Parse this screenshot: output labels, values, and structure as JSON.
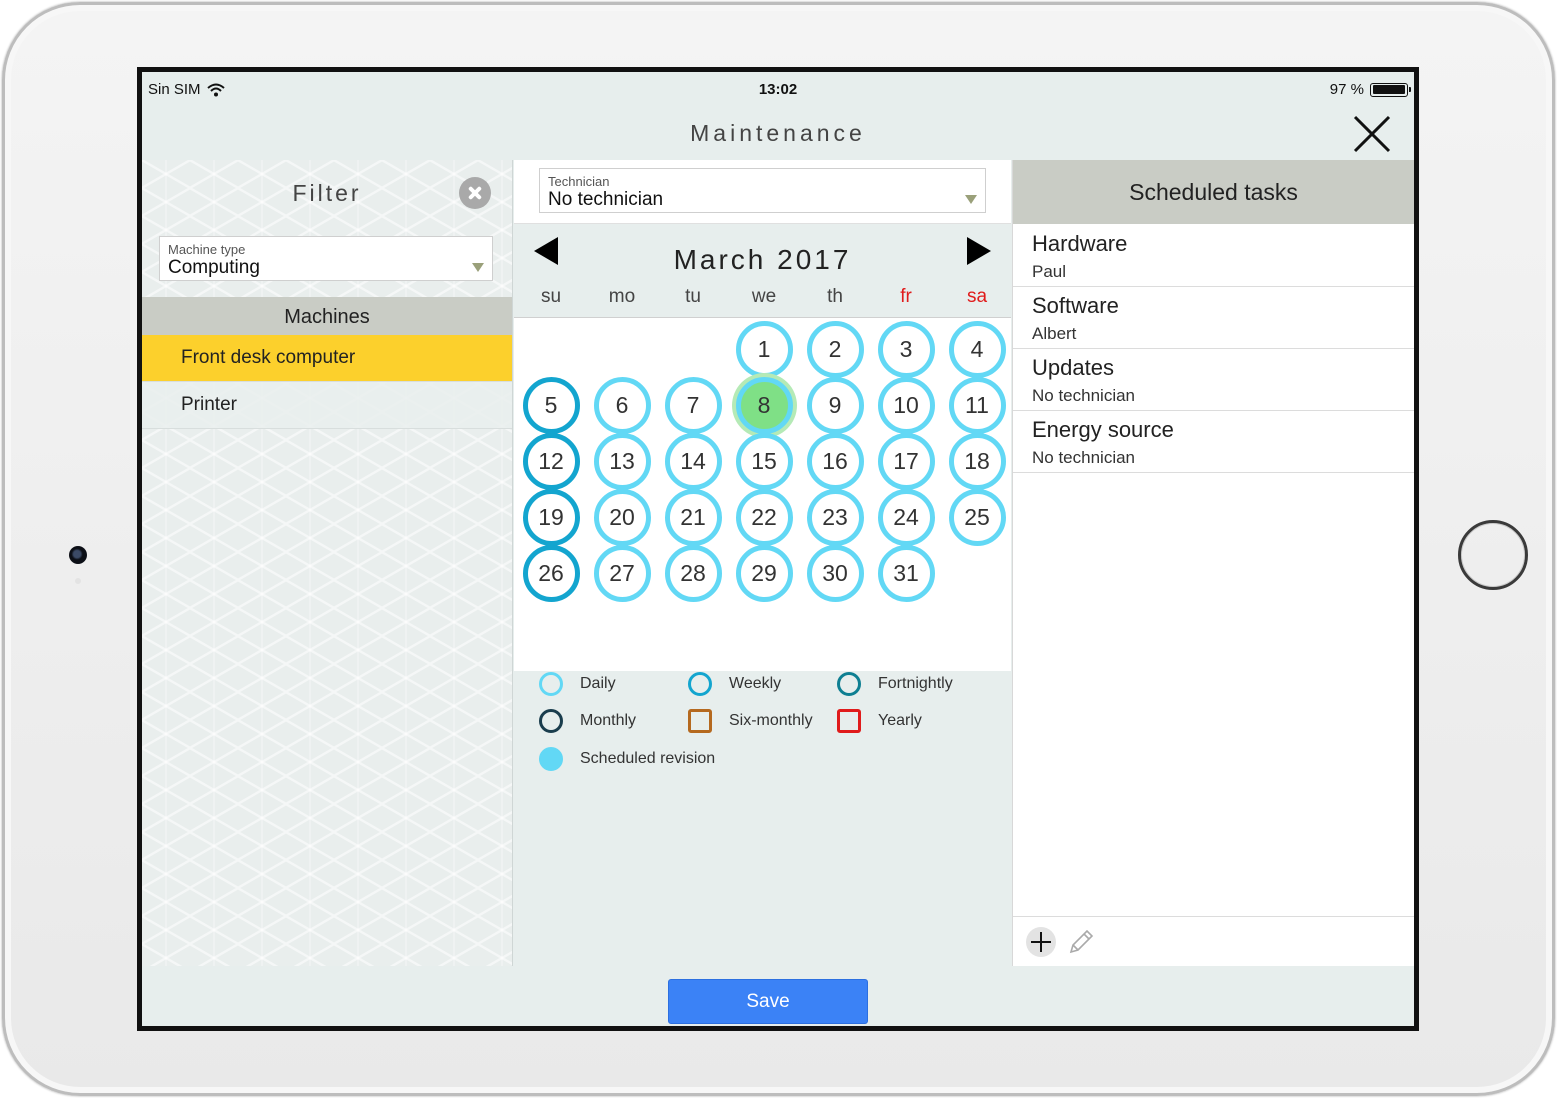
{
  "status_bar": {
    "carrier": "Sin SIM",
    "time": "13:02",
    "battery_text": "97 %",
    "battery_level": 0.97
  },
  "nav": {
    "title": "Maintenance",
    "close_icon": "close-icon"
  },
  "filter": {
    "title": "Filter",
    "clear_icon": "clear-filter-icon",
    "machine_type": {
      "label": "Machine type",
      "value": "Computing"
    },
    "machines_header": "Machines",
    "machines": [
      {
        "label": "Front desk computer",
        "selected": true
      },
      {
        "label": "Printer",
        "selected": false
      }
    ]
  },
  "calendar": {
    "technician": {
      "label": "Technician",
      "value": "No technician"
    },
    "month_title": "March 2017",
    "prev_icon": "triangle-left-icon",
    "next_icon": "triangle-right-icon",
    "weekdays": [
      "su",
      "mo",
      "tu",
      "we",
      "th",
      "fr",
      "sa"
    ],
    "weekend_color": "#e01b1b",
    "first_weekday_index": 3,
    "days_in_month": 31,
    "selected_day": 8,
    "colors": {
      "daily": "#62d8f5",
      "weekly": "#13a5cf",
      "selected_fill": "#7fe086"
    },
    "legend": [
      {
        "label": "Daily",
        "color": "#62d8f5",
        "shape": "circle"
      },
      {
        "label": "Weekly",
        "color": "#13a5cf",
        "shape": "circle"
      },
      {
        "label": "Fortnightly",
        "color": "#0e7f92",
        "shape": "circle"
      },
      {
        "label": "Monthly",
        "color": "#1a3d4d",
        "shape": "circle"
      },
      {
        "label": "Six-monthly",
        "color": "#b5691f",
        "shape": "square"
      },
      {
        "label": "Yearly",
        "color": "#e01b1b",
        "shape": "square"
      },
      {
        "label": "Scheduled revision",
        "color": "#62d8f5",
        "shape": "filled-circle"
      }
    ]
  },
  "tasks": {
    "header": "Scheduled tasks",
    "items": [
      {
        "name": "Hardware",
        "technician": "Paul"
      },
      {
        "name": "Software",
        "technician": "Albert"
      },
      {
        "name": "Updates",
        "technician": "No technician"
      },
      {
        "name": "Energy source",
        "technician": "No technician"
      }
    ],
    "add_icon": "plus-icon",
    "edit_icon": "pencil-icon"
  },
  "save_label": "Save"
}
